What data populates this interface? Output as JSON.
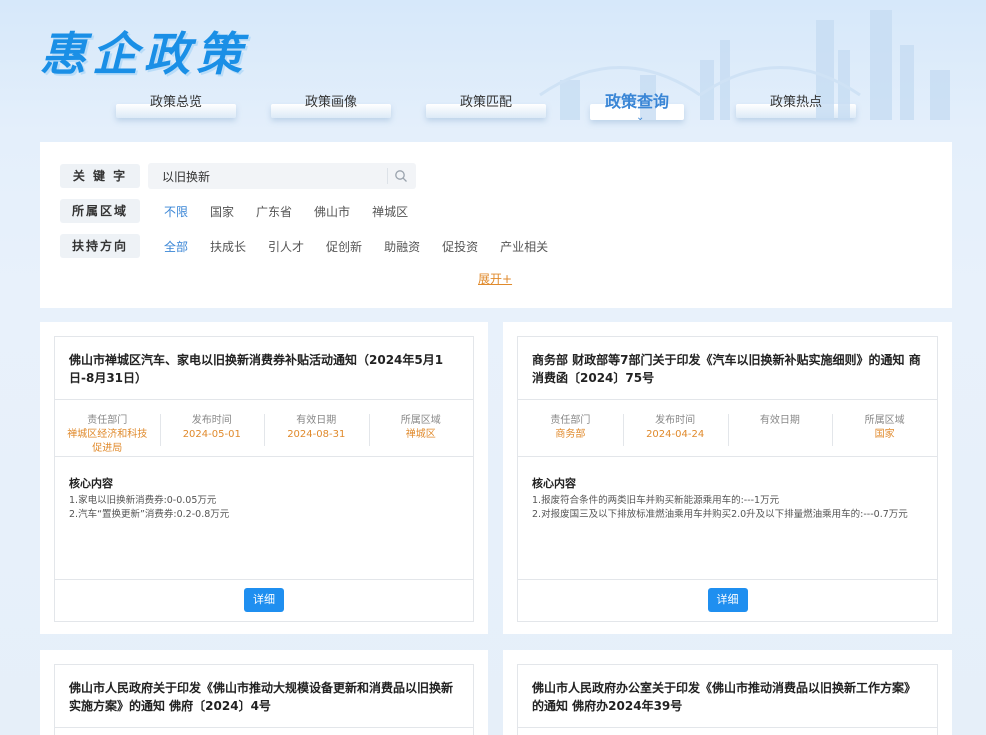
{
  "logo": "惠企政策",
  "nav": [
    {
      "label": "政策总览"
    },
    {
      "label": "政策画像"
    },
    {
      "label": "政策匹配"
    },
    {
      "label": "政策查询"
    },
    {
      "label": "政策热点"
    }
  ],
  "filters": {
    "keyword_label": "关 键 字",
    "keyword_value": "以旧换新",
    "region_label": "所属区域",
    "region_options": [
      "不限",
      "国家",
      "广东省",
      "佛山市",
      "禅城区"
    ],
    "region_selected": "不限",
    "support_label": "扶持方向",
    "support_options": [
      "全部",
      "扶成长",
      "引人才",
      "促创新",
      "助融资",
      "促投资",
      "产业相关"
    ],
    "support_selected": "全部",
    "expand_label": "展开+"
  },
  "meta_labels": {
    "dept": "责任部门",
    "publish": "发布时间",
    "valid": "有效日期",
    "region": "所属区域"
  },
  "core_label": "核心内容",
  "detail_label": "详细",
  "cards": [
    {
      "title": "佛山市禅城区汽车、家电以旧换新消费券补贴活动通知（2024年5月1日-8月31日）",
      "dept": "禅城区经济和科技促进局",
      "publish": "2024-05-01",
      "valid": "2024-08-31",
      "region": "禅城区",
      "core": [
        "1.家电以旧换新消费券:0-0.05万元",
        "2.汽车“置换更新”消费券:0.2-0.8万元"
      ]
    },
    {
      "title": "商务部 财政部等7部门关于印发《汽车以旧换新补贴实施细则》的通知 商消费函〔2024〕75号",
      "dept": "商务部",
      "publish": "2024-04-24",
      "valid": "",
      "region": "国家",
      "core": [
        "1.报废符合条件的两类旧车并购买新能源乘用车的:---1万元",
        "2.对报废国三及以下排放标准燃油乘用车并购买2.0升及以下排量燃油乘用车的:---0.7万元"
      ]
    },
    {
      "title": "佛山市人民政府关于印发《佛山市推动大规模设备更新和消费品以旧换新实施方案》的通知 佛府〔2024〕4号"
    },
    {
      "title": "佛山市人民政府办公室关于印发《佛山市推动消费品以旧换新工作方案》的通知 佛府办2024年39号"
    }
  ]
}
